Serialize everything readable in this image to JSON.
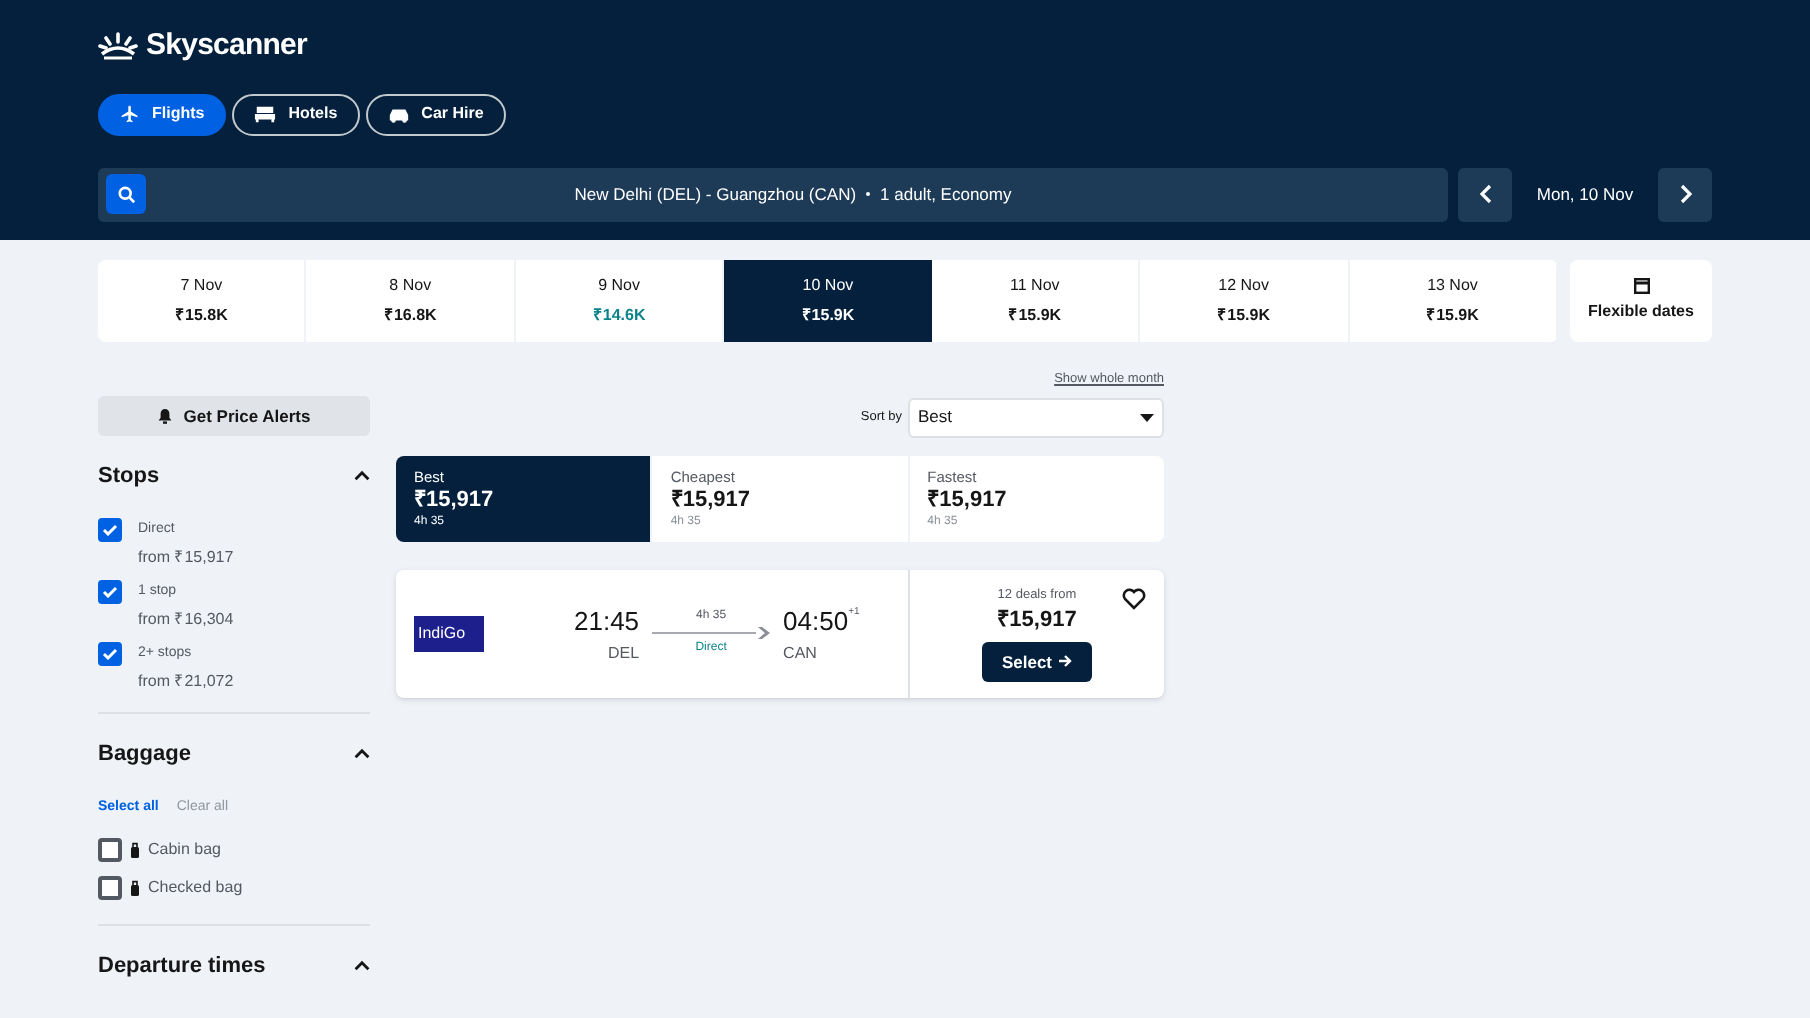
{
  "logo": {
    "text": "Skyscanner"
  },
  "nav_tabs": [
    {
      "label": "Flights",
      "kind": "plane",
      "selected": true
    },
    {
      "label": "Hotels",
      "kind": "bed",
      "selected": false
    },
    {
      "label": "Car Hire",
      "kind": "car",
      "selected": false
    }
  ],
  "search": {
    "route": "New Delhi (DEL) - Guangzhou (CAN)",
    "travellers": "1 adult, Economy",
    "date": "Mon, 10 Nov"
  },
  "dates": [
    {
      "date": "7 Nov",
      "price": "₹15.8K",
      "cheapest": false,
      "selected": false
    },
    {
      "date": "8 Nov",
      "price": "₹16.8K",
      "cheapest": false,
      "selected": false
    },
    {
      "date": "9 Nov",
      "price": "₹14.6K",
      "cheapest": true,
      "selected": false
    },
    {
      "date": "10 Nov",
      "price": "₹15.9K",
      "cheapest": false,
      "selected": true
    },
    {
      "date": "11 Nov",
      "price": "₹15.9K",
      "cheapest": false,
      "selected": false
    },
    {
      "date": "12 Nov",
      "price": "₹15.9K",
      "cheapest": false,
      "selected": false
    },
    {
      "date": "13 Nov",
      "price": "₹15.9K",
      "cheapest": false,
      "selected": false
    }
  ],
  "flexible_dates": "Flexible dates",
  "show_whole_month": "Show whole month",
  "price_alerts": "Get Price Alerts",
  "stops": {
    "title": "Stops",
    "expanded": true,
    "options": [
      {
        "label": "Direct",
        "price": "from ₹15,917",
        "checked": true
      },
      {
        "label": "1 stop",
        "price": "from ₹16,304",
        "checked": true
      },
      {
        "label": "2+ stops",
        "price": "from ₹21,072",
        "checked": true
      }
    ]
  },
  "baggage": {
    "title": "Baggage",
    "expanded": true,
    "select_all": "Select all",
    "clear_all": "Clear all",
    "options": [
      {
        "label": "Cabin bag",
        "checked": false
      },
      {
        "label": "Checked bag",
        "checked": false
      }
    ]
  },
  "departure_times": {
    "title": "Departure times",
    "expanded": true
  },
  "sort": {
    "label": "Sort by",
    "value": "Best"
  },
  "sort_tabs": [
    {
      "label": "Best",
      "price": "₹15,917",
      "duration": "4h 35",
      "selected": true
    },
    {
      "label": "Cheapest",
      "price": "₹15,917",
      "duration": "4h 35",
      "selected": false
    },
    {
      "label": "Fastest",
      "price": "₹15,917",
      "duration": "4h 35",
      "selected": false
    }
  ],
  "result": {
    "airline": "IndiGo",
    "depart_time": "21:45",
    "depart_airport": "DEL",
    "duration": "4h 35",
    "stops": "Direct",
    "arrive_time": "04:50",
    "day_offset": "+1",
    "arrive_airport": "CAN",
    "deals": "12 deals from",
    "price": "₹15,917",
    "select": "Select",
    "saved": false
  }
}
